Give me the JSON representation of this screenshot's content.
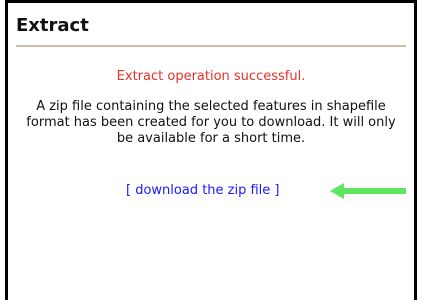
{
  "panel": {
    "title": "Extract",
    "status_message": "Extract operation successful.",
    "body_text": "A zip file containing the selected features in shapefile format has been created for you to download. It will only be available for a short time.",
    "download_link_label": "[ download the zip file ]"
  },
  "colors": {
    "status": "#e8302a",
    "link": "#1a1aff",
    "arrow": "#5ee65e"
  },
  "icons": {
    "pointer_arrow": "left-arrow-icon"
  }
}
